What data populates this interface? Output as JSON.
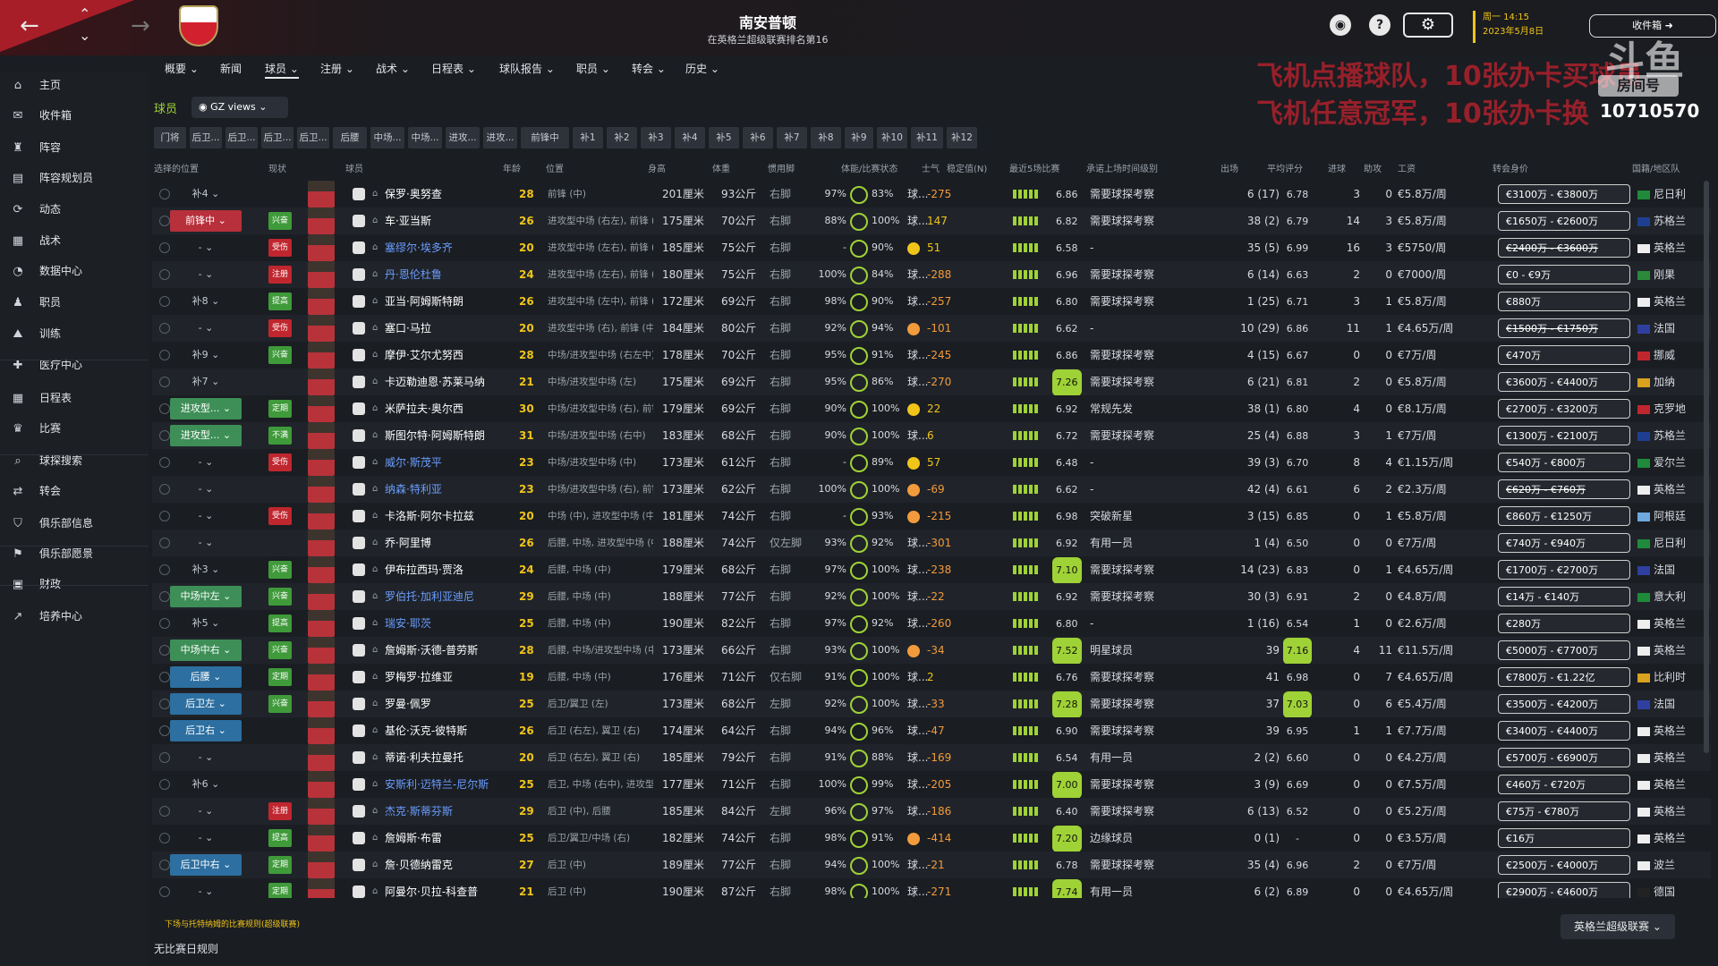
{
  "header": {
    "title": "南安普顿",
    "subtitle": "在英格兰超级联赛排名第16",
    "time": "周一 14:15",
    "date": "2023年5月8日",
    "inbox": "收件箱"
  },
  "overlay": {
    "line1": "飞机点播球队，10张办卡买球员",
    "line2": "飞机任意冠军，10张办卡换",
    "wm_text": "房间号",
    "room_id": "10710570"
  },
  "sidebar": [
    {
      "label": "主页",
      "icon": "home-icon"
    },
    {
      "label": "收件箱",
      "icon": "inbox-icon"
    },
    {
      "label": "阵容",
      "icon": "squad-icon"
    },
    {
      "label": "阵容规划员",
      "icon": "planner-icon"
    },
    {
      "label": "动态",
      "icon": "dynamics-icon"
    },
    {
      "label": "战术",
      "icon": "tactics-icon"
    },
    {
      "label": "数据中心",
      "icon": "data-icon"
    },
    {
      "label": "职员",
      "icon": "staff-icon"
    },
    {
      "label": "训练",
      "icon": "training-icon"
    },
    {
      "label": "医疗中心",
      "icon": "medical-icon"
    },
    {
      "label": "日程表",
      "icon": "calendar-icon"
    },
    {
      "label": "比赛",
      "icon": "trophy-icon"
    },
    {
      "label": "球探搜索",
      "icon": "search-icon"
    },
    {
      "label": "转会",
      "icon": "transfer-icon"
    },
    {
      "label": "俱乐部信息",
      "icon": "shield-icon"
    },
    {
      "label": "俱乐部愿景",
      "icon": "vision-icon"
    },
    {
      "label": "财政",
      "icon": "finance-icon"
    },
    {
      "label": "培养中心",
      "icon": "development-icon"
    }
  ],
  "menu": [
    "概要",
    "新闻",
    "球员",
    "注册",
    "战术",
    "日程表",
    "球队报告",
    "职员",
    "转会",
    "历史"
  ],
  "section": "球员",
  "view": "GZ views",
  "chips": [
    "门将",
    "后卫...",
    "后卫...",
    "后卫...",
    "后卫...",
    "后腰",
    "中场...",
    "中场...",
    "进攻...",
    "进攻...",
    "前锋中",
    "补1",
    "补2",
    "补3",
    "补4",
    "补5",
    "补6",
    "补7",
    "补8",
    "补9",
    "补10",
    "补11",
    "补12"
  ],
  "columns": [
    "选择的位置",
    "现状",
    "球员",
    "年龄",
    "位置",
    "身高",
    "体重",
    "惯用脚",
    "体能/比赛状态",
    "士气",
    "稳定值(N)",
    "最近5场比赛",
    "承诺上场时间级别",
    "出场",
    "平均评分",
    "进球",
    "助攻",
    "工资",
    "转会身价",
    "国籍/地区队"
  ],
  "players": [
    {
      "pos": "补4",
      "status": "",
      "name": "保罗·奥努查",
      "age": "28",
      "role": "前锋 (中)",
      "h": "201厘米",
      "w": "93公斤",
      "foot": "右脚",
      "fit": "97%",
      "cond": "83%",
      "morale": "球...",
      "form": "-275",
      "last5": "6.86",
      "tier": "需要球探考察",
      "apps": "6 (17)",
      "avg": "6.78",
      "gl": "3",
      "as": "0",
      "wage": "€5.8万/周",
      "value": "€3100万 - €3800万",
      "nat": "尼日利"
    },
    {
      "pos": "前锋中",
      "status": "兴奋",
      "name": "车·亚当斯",
      "age": "26",
      "role": "进攻型中场 (右左), 前锋 (中)",
      "h": "175厘米",
      "w": "70公斤",
      "foot": "右脚",
      "fit": "88%",
      "cond": "100%",
      "morale": "球...",
      "form": "147",
      "last5": "6.82",
      "tier": "需要球探考察",
      "apps": "38 (2)",
      "avg": "6.79",
      "gl": "14",
      "as": "3",
      "wage": "€5.8万/周",
      "value": "€1650万 - €2600万",
      "nat": "苏格兰"
    },
    {
      "pos": "-",
      "status": "受伤",
      "name": "塞缪尔·埃多齐",
      "age": "20",
      "role": "进攻型中场 (左右), 前锋 (中)",
      "h": "185厘米",
      "w": "75公斤",
      "foot": "右脚",
      "fit": "-",
      "cond": "90%",
      "morale": "",
      "form": "51",
      "last5": "6.58",
      "tier": "-",
      "apps": "35 (5)",
      "avg": "6.99",
      "gl": "16",
      "as": "3",
      "wage": "€5750/周",
      "value": "€2400万 - €3600万",
      "nat": "英格兰"
    },
    {
      "pos": "-",
      "status": "注册",
      "name": "丹·恩伦杜鲁",
      "age": "24",
      "role": "进攻型中场 (左右), 前锋 (中)",
      "h": "180厘米",
      "w": "75公斤",
      "foot": "右脚",
      "fit": "100%",
      "cond": "84%",
      "morale": "球...",
      "form": "-288",
      "last5": "6.96",
      "tier": "需要球探考察",
      "apps": "6 (14)",
      "avg": "6.63",
      "gl": "2",
      "as": "0",
      "wage": "€7000/周",
      "value": "€0 - €9万",
      "nat": "刚果"
    },
    {
      "pos": "补8",
      "status": "提高",
      "name": "亚当·阿姆斯特朗",
      "age": "26",
      "role": "进攻型中场 (左中), 前锋 (中)",
      "h": "172厘米",
      "w": "69公斤",
      "foot": "右脚",
      "fit": "98%",
      "cond": "90%",
      "morale": "球...",
      "form": "-257",
      "last5": "6.80",
      "tier": "需要球探考察",
      "apps": "1 (25)",
      "avg": "6.71",
      "gl": "3",
      "as": "1",
      "wage": "€5.8万/周",
      "value": "€880万",
      "nat": "英格兰"
    },
    {
      "pos": "-",
      "status": "受伤",
      "name": "塞口·马拉",
      "age": "20",
      "role": "进攻型中场 (右), 前锋 (中)",
      "h": "184厘米",
      "w": "80公斤",
      "foot": "右脚",
      "fit": "92%",
      "cond": "94%",
      "morale": "",
      "form": "-101",
      "last5": "6.62",
      "tier": "-",
      "apps": "10 (29)",
      "avg": "6.86",
      "gl": "11",
      "as": "1",
      "wage": "€4.65万/周",
      "value": "€1500万 - €1750万",
      "nat": "法国"
    },
    {
      "pos": "补9",
      "status": "兴奋",
      "name": "摩伊·艾尔尤努西",
      "age": "28",
      "role": "中场/进攻型中场 (右左中)",
      "h": "178厘米",
      "w": "70公斤",
      "foot": "右脚",
      "fit": "95%",
      "cond": "91%",
      "morale": "球...",
      "form": "-245",
      "last5": "6.86",
      "tier": "需要球探考察",
      "apps": "4 (15)",
      "avg": "6.67",
      "gl": "0",
      "as": "0",
      "wage": "€7万/周",
      "value": "€470万",
      "nat": "挪威"
    },
    {
      "pos": "补7",
      "status": "",
      "name": "卡迈勒迪恩·苏莱马纳",
      "age": "21",
      "role": "中场/进攻型中场 (左)",
      "h": "175厘米",
      "w": "69公斤",
      "foot": "右脚",
      "fit": "95%",
      "cond": "86%",
      "morale": "球...",
      "form": "-270",
      "last5": "7.26",
      "tier": "需要球探考察",
      "apps": "6 (21)",
      "avg": "6.81",
      "gl": "2",
      "as": "0",
      "wage": "€5.8万/周",
      "value": "€3600万 - €4400万",
      "nat": "加纳"
    },
    {
      "pos": "进攻型...",
      "status": "定期",
      "name": "米萨拉夫·奥尔西",
      "age": "30",
      "role": "中场/进攻型中场 (右), 前锋 (中)",
      "h": "179厘米",
      "w": "69公斤",
      "foot": "右脚",
      "fit": "90%",
      "cond": "100%",
      "morale": "",
      "form": "22",
      "last5": "6.92",
      "tier": "常规先发",
      "apps": "38 (1)",
      "avg": "6.80",
      "gl": "4",
      "as": "0",
      "wage": "€8.1万/周",
      "value": "€2700万 - €3200万",
      "nat": "克罗地"
    },
    {
      "pos": "进攻型...",
      "status": "不满",
      "name": "斯图尔特·阿姆斯特朗",
      "age": "31",
      "role": "中场/进攻型中场 (右中)",
      "h": "183厘米",
      "w": "68公斤",
      "foot": "右脚",
      "fit": "90%",
      "cond": "100%",
      "morale": "球...",
      "form": "6",
      "last5": "6.72",
      "tier": "需要球探考察",
      "apps": "25 (4)",
      "avg": "6.88",
      "gl": "3",
      "as": "1",
      "wage": "€7万/周",
      "value": "€1300万 - €2100万",
      "nat": "苏格兰"
    },
    {
      "pos": "-",
      "status": "受伤",
      "name": "威尔·斯茂平",
      "age": "23",
      "role": "中场/进攻型中场 (中)",
      "h": "173厘米",
      "w": "61公斤",
      "foot": "右脚",
      "fit": "-",
      "cond": "89%",
      "morale": "",
      "form": "57",
      "last5": "6.48",
      "tier": "-",
      "apps": "39 (3)",
      "avg": "6.70",
      "gl": "8",
      "as": "4",
      "wage": "€1.15万/周",
      "value": "€540万 - €800万",
      "nat": "爱尔兰"
    },
    {
      "pos": "-",
      "status": "",
      "name": "纳森·特利亚",
      "age": "23",
      "role": "中场/进攻型中场 (右), 前锋 (中)",
      "h": "173厘米",
      "w": "62公斤",
      "foot": "右脚",
      "fit": "100%",
      "cond": "100%",
      "morale": "",
      "form": "-69",
      "last5": "6.62",
      "tier": "-",
      "apps": "42 (4)",
      "avg": "6.61",
      "gl": "6",
      "as": "2",
      "wage": "€2.3万/周",
      "value": "€620万 - €760万",
      "nat": "英格兰"
    },
    {
      "pos": "-",
      "status": "受伤",
      "name": "卡洛斯·阿尔卡拉兹",
      "age": "20",
      "role": "中场 (中), 进攻型中场 (中)",
      "h": "181厘米",
      "w": "74公斤",
      "foot": "右脚",
      "fit": "-",
      "cond": "93%",
      "morale": "",
      "form": "-215",
      "last5": "6.98",
      "tier": "突破新星",
      "apps": "3 (15)",
      "avg": "6.85",
      "gl": "0",
      "as": "1",
      "wage": "€5.8万/周",
      "value": "€860万 - €1250万",
      "nat": "阿根廷"
    },
    {
      "pos": "-",
      "status": "",
      "name": "乔·阿里博",
      "age": "26",
      "role": "后腰, 中场, 进攻型中场 (中)",
      "h": "188厘米",
      "w": "74公斤",
      "foot": "仅左脚",
      "fit": "93%",
      "cond": "92%",
      "morale": "球...",
      "form": "-301",
      "last5": "6.92",
      "tier": "有用一员",
      "apps": "1 (4)",
      "avg": "6.50",
      "gl": "0",
      "as": "0",
      "wage": "€7万/周",
      "value": "€740万 - €940万",
      "nat": "尼日利"
    },
    {
      "pos": "补3",
      "status": "兴奋",
      "name": "伊布拉西玛·贾洛",
      "age": "24",
      "role": "后腰, 中场 (中)",
      "h": "179厘米",
      "w": "68公斤",
      "foot": "右脚",
      "fit": "97%",
      "cond": "100%",
      "morale": "球...",
      "form": "-238",
      "last5": "7.10",
      "tier": "需要球探考察",
      "apps": "14 (23)",
      "avg": "6.83",
      "gl": "0",
      "as": "1",
      "wage": "€4.65万/周",
      "value": "€1700万 - €2700万",
      "nat": "法国"
    },
    {
      "pos": "中场中左",
      "status": "兴奋",
      "name": "罗伯托·加利亚迪尼",
      "age": "29",
      "role": "后腰, 中场 (中)",
      "h": "188厘米",
      "w": "77公斤",
      "foot": "右脚",
      "fit": "92%",
      "cond": "100%",
      "morale": "球...",
      "form": "-22",
      "last5": "6.92",
      "tier": "需要球探考察",
      "apps": "30 (3)",
      "avg": "6.91",
      "gl": "2",
      "as": "0",
      "wage": "€4.8万/周",
      "value": "€14万 - €140万",
      "nat": "意大利"
    },
    {
      "pos": "补5",
      "status": "提高",
      "name": "瑞安·耶茨",
      "age": "25",
      "role": "后腰, 中场 (中)",
      "h": "190厘米",
      "w": "82公斤",
      "foot": "右脚",
      "fit": "97%",
      "cond": "92%",
      "morale": "球...",
      "form": "-260",
      "last5": "6.80",
      "tier": "-",
      "apps": "1 (16)",
      "avg": "6.54",
      "gl": "1",
      "as": "0",
      "wage": "€2.6万/周",
      "value": "€280万",
      "nat": "英格兰"
    },
    {
      "pos": "中场中右",
      "status": "兴奋",
      "name": "詹姆斯·沃德-普劳斯",
      "age": "28",
      "role": "后腰, 中场/进攻型中场 (中)",
      "h": "173厘米",
      "w": "66公斤",
      "foot": "右脚",
      "fit": "93%",
      "cond": "100%",
      "morale": "",
      "form": "-34",
      "last5": "7.52",
      "tier": "明星球员",
      "apps": "39",
      "avg": "7.16",
      "gl": "4",
      "as": "11",
      "wage": "€11.5万/周",
      "value": "€5000万 - €7700万",
      "nat": "英格兰"
    },
    {
      "pos": "后腰",
      "status": "定期",
      "name": "罗梅罗·拉维亚",
      "age": "19",
      "role": "后腰, 中场 (中)",
      "h": "176厘米",
      "w": "71公斤",
      "foot": "仅右脚",
      "fit": "91%",
      "cond": "100%",
      "morale": "球...",
      "form": "2",
      "last5": "6.76",
      "tier": "需要球探考察",
      "apps": "41",
      "avg": "6.98",
      "gl": "0",
      "as": "7",
      "wage": "€4.65万/周",
      "value": "€7800万 - €1.22亿",
      "nat": "比利时"
    },
    {
      "pos": "后卫左",
      "status": "兴奋",
      "name": "罗曼·佩罗",
      "age": "25",
      "role": "后卫/翼卫 (左)",
      "h": "173厘米",
      "w": "68公斤",
      "foot": "左脚",
      "fit": "92%",
      "cond": "100%",
      "morale": "球...",
      "form": "-33",
      "last5": "7.28",
      "tier": "需要球探考察",
      "apps": "37",
      "avg": "7.03",
      "gl": "0",
      "as": "6",
      "wage": "€5.4万/周",
      "value": "€3500万 - €4200万",
      "nat": "法国"
    },
    {
      "pos": "后卫右",
      "status": "",
      "name": "基伦·沃克-彼特斯",
      "age": "26",
      "role": "后卫 (右左), 翼卫 (右)",
      "h": "174厘米",
      "w": "64公斤",
      "foot": "右脚",
      "fit": "94%",
      "cond": "96%",
      "morale": "球...",
      "form": "-47",
      "last5": "6.90",
      "tier": "需要球探考察",
      "apps": "39",
      "avg": "6.95",
      "gl": "1",
      "as": "1",
      "wage": "€7.7万/周",
      "value": "€3400万 - €4400万",
      "nat": "英格兰"
    },
    {
      "pos": "-",
      "status": "",
      "name": "蒂诺·利夫拉曼托",
      "age": "20",
      "role": "后卫 (右左), 翼卫 (右)",
      "h": "185厘米",
      "w": "79公斤",
      "foot": "右脚",
      "fit": "91%",
      "cond": "88%",
      "morale": "球...",
      "form": "-169",
      "last5": "6.54",
      "tier": "有用一员",
      "apps": "2 (2)",
      "avg": "6.60",
      "gl": "0",
      "as": "0",
      "wage": "€4.2万/周",
      "value": "€5700万 - €6900万",
      "nat": "英格兰"
    },
    {
      "pos": "补6",
      "status": "",
      "name": "安斯利·迈特兰-尼尔斯",
      "age": "25",
      "role": "后卫, 中场 (右中), 进攻型中场 (右)",
      "h": "177厘米",
      "w": "71公斤",
      "foot": "右脚",
      "fit": "100%",
      "cond": "99%",
      "morale": "球...",
      "form": "-205",
      "last5": "7.00",
      "tier": "需要球探考察",
      "apps": "3 (9)",
      "avg": "6.69",
      "gl": "0",
      "as": "0",
      "wage": "€7.5万/周",
      "value": "€460万 - €720万",
      "nat": "英格兰"
    },
    {
      "pos": "-",
      "status": "注册",
      "name": "杰克·斯蒂芬斯",
      "age": "29",
      "role": "后卫 (中), 后腰",
      "h": "185厘米",
      "w": "84公斤",
      "foot": "左脚",
      "fit": "96%",
      "cond": "97%",
      "morale": "球...",
      "form": "-186",
      "last5": "6.40",
      "tier": "需要球探考察",
      "apps": "6 (13)",
      "avg": "6.52",
      "gl": "0",
      "as": "0",
      "wage": "€5.2万/周",
      "value": "€75万 - €780万",
      "nat": "英格兰"
    },
    {
      "pos": "-",
      "status": "提高",
      "name": "詹姆斯·布雷",
      "age": "25",
      "role": "后卫/翼卫/中场 (右)",
      "h": "182厘米",
      "w": "74公斤",
      "foot": "右脚",
      "fit": "98%",
      "cond": "91%",
      "morale": "",
      "form": "-414",
      "last5": "7.20",
      "tier": "边缘球员",
      "apps": "0 (1)",
      "avg": "-",
      "gl": "0",
      "as": "0",
      "wage": "€3.5万/周",
      "value": "€16万",
      "nat": "英格兰"
    },
    {
      "pos": "后卫中右",
      "status": "定期",
      "name": "詹·贝德纳雷克",
      "age": "27",
      "role": "后卫 (中)",
      "h": "189厘米",
      "w": "77公斤",
      "foot": "右脚",
      "fit": "94%",
      "cond": "100%",
      "morale": "球...",
      "form": "-21",
      "last5": "6.78",
      "tier": "需要球探考察",
      "apps": "35 (4)",
      "avg": "6.96",
      "gl": "2",
      "as": "0",
      "wage": "€7万/周",
      "value": "€2500万 - €4000万",
      "nat": "波兰"
    },
    {
      "pos": "-",
      "status": "定期",
      "name": "阿曼尔·贝拉-科查普",
      "age": "21",
      "role": "后卫 (中)",
      "h": "190厘米",
      "w": "87公斤",
      "foot": "右脚",
      "fit": "98%",
      "cond": "100%",
      "morale": "球...",
      "form": "-271",
      "last5": "7.74",
      "tier": "有用一员",
      "apps": "6 (2)",
      "avg": "6.89",
      "gl": "0",
      "as": "0",
      "wage": "€4.65万/周",
      "value": "€2900万 - €4600万",
      "nat": "德国"
    }
  ],
  "footer": {
    "note": "下场与托特纳姆的比赛规则(超级联赛)",
    "btn": "无比赛日规则",
    "league": "英格兰超级联赛"
  },
  "colors": {
    "accent": "#9fd236",
    "status_green": "#3f9a3a",
    "status_red": "#c0262e",
    "pos_green": "#3e8f57",
    "pos_red": "#b8303b",
    "pos_blue": "#2d6fa0"
  }
}
